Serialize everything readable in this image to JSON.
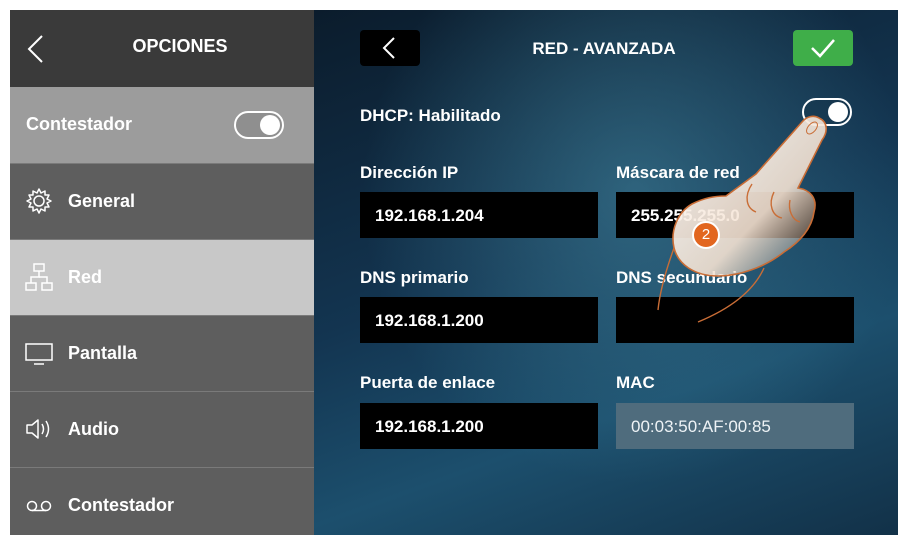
{
  "sidebar": {
    "title": "OPCIONES",
    "toggle_row": {
      "label": "Contestador",
      "enabled": true
    },
    "items": [
      {
        "label": "General",
        "icon": "gear-icon",
        "active": false
      },
      {
        "label": "Red",
        "icon": "network-icon",
        "active": true
      },
      {
        "label": "Pantalla",
        "icon": "monitor-icon",
        "active": false
      },
      {
        "label": "Audio",
        "icon": "speaker-icon",
        "active": false
      },
      {
        "label": "Contestador",
        "icon": "voicemail-icon",
        "active": false
      }
    ]
  },
  "header": {
    "title": "RED - AVANZADA",
    "back_icon": "chevron-left-icon",
    "confirm_icon": "checkmark-icon"
  },
  "dhcp": {
    "label": "DHCP: Habilitado",
    "enabled": true
  },
  "fields": {
    "ip": {
      "label": "Dirección IP",
      "value": "192.168.1.204"
    },
    "mask": {
      "label": "Máscara de red",
      "value": "255.255.255.0"
    },
    "dns1": {
      "label": "DNS primario",
      "value": "192.168.1.200"
    },
    "dns2": {
      "label": "DNS secundario",
      "value": ""
    },
    "gateway": {
      "label": "Puerta de enlace",
      "value": "192.168.1.200"
    },
    "mac": {
      "label": "MAC",
      "value": "00:03:50:AF:00:85"
    }
  },
  "overlay": {
    "step": "2"
  },
  "colors": {
    "confirm": "#3fae49",
    "active_item": "#c8c8c8",
    "badge": "#e2661f"
  }
}
